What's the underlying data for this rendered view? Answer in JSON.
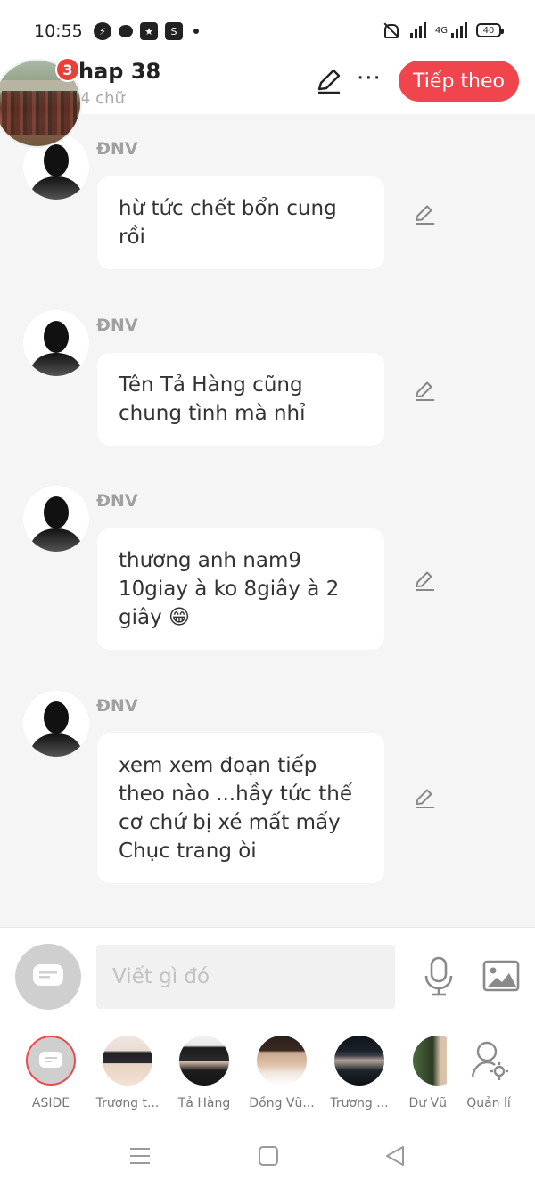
{
  "status": {
    "time": "10:55",
    "battery": "40",
    "network": "4G"
  },
  "header": {
    "title_visible": "hap 38",
    "subtitle_visible": "4 chữ",
    "badge_count": "3",
    "next_button": "Tiếp theo"
  },
  "comments": [
    {
      "author": "ĐNV",
      "text": "hừ tức chết bổn cung rồi"
    },
    {
      "author": "ĐNV",
      "text": "Tên Tả Hàng cũng chung tình mà nhỉ"
    },
    {
      "author": "ĐNV",
      "text": "thương anh nam9 10giay à ko 8giây à 2 giây 😁"
    },
    {
      "author": "ĐNV",
      "text": "xem xem đoạn tiếp theo nào ...hầy tức thế cơ chứ bị xé mất mấy Chục trang òi"
    }
  ],
  "composer": {
    "placeholder": "Viết gì đó"
  },
  "strip": [
    {
      "label": "ASIDE"
    },
    {
      "label": "Trương t..."
    },
    {
      "label": "Tả Hàng"
    },
    {
      "label": "Đồng Vũ..."
    },
    {
      "label": "Trương ..."
    },
    {
      "label": "Dư Vũ"
    },
    {
      "label": "Quản lí"
    }
  ],
  "colors": {
    "accent": "#f0454c",
    "badge": "#ea3f3a"
  },
  "icons": [
    "messenger-icon",
    "chat-icon",
    "star-app-icon",
    "shopee-icon",
    "bell-off-icon",
    "signal-icon",
    "battery-icon",
    "pencil-icon",
    "more-icon",
    "chat-bubble-icon",
    "microphone-icon",
    "image-icon",
    "user-settings-icon",
    "menu-icon",
    "home-icon",
    "back-icon"
  ]
}
